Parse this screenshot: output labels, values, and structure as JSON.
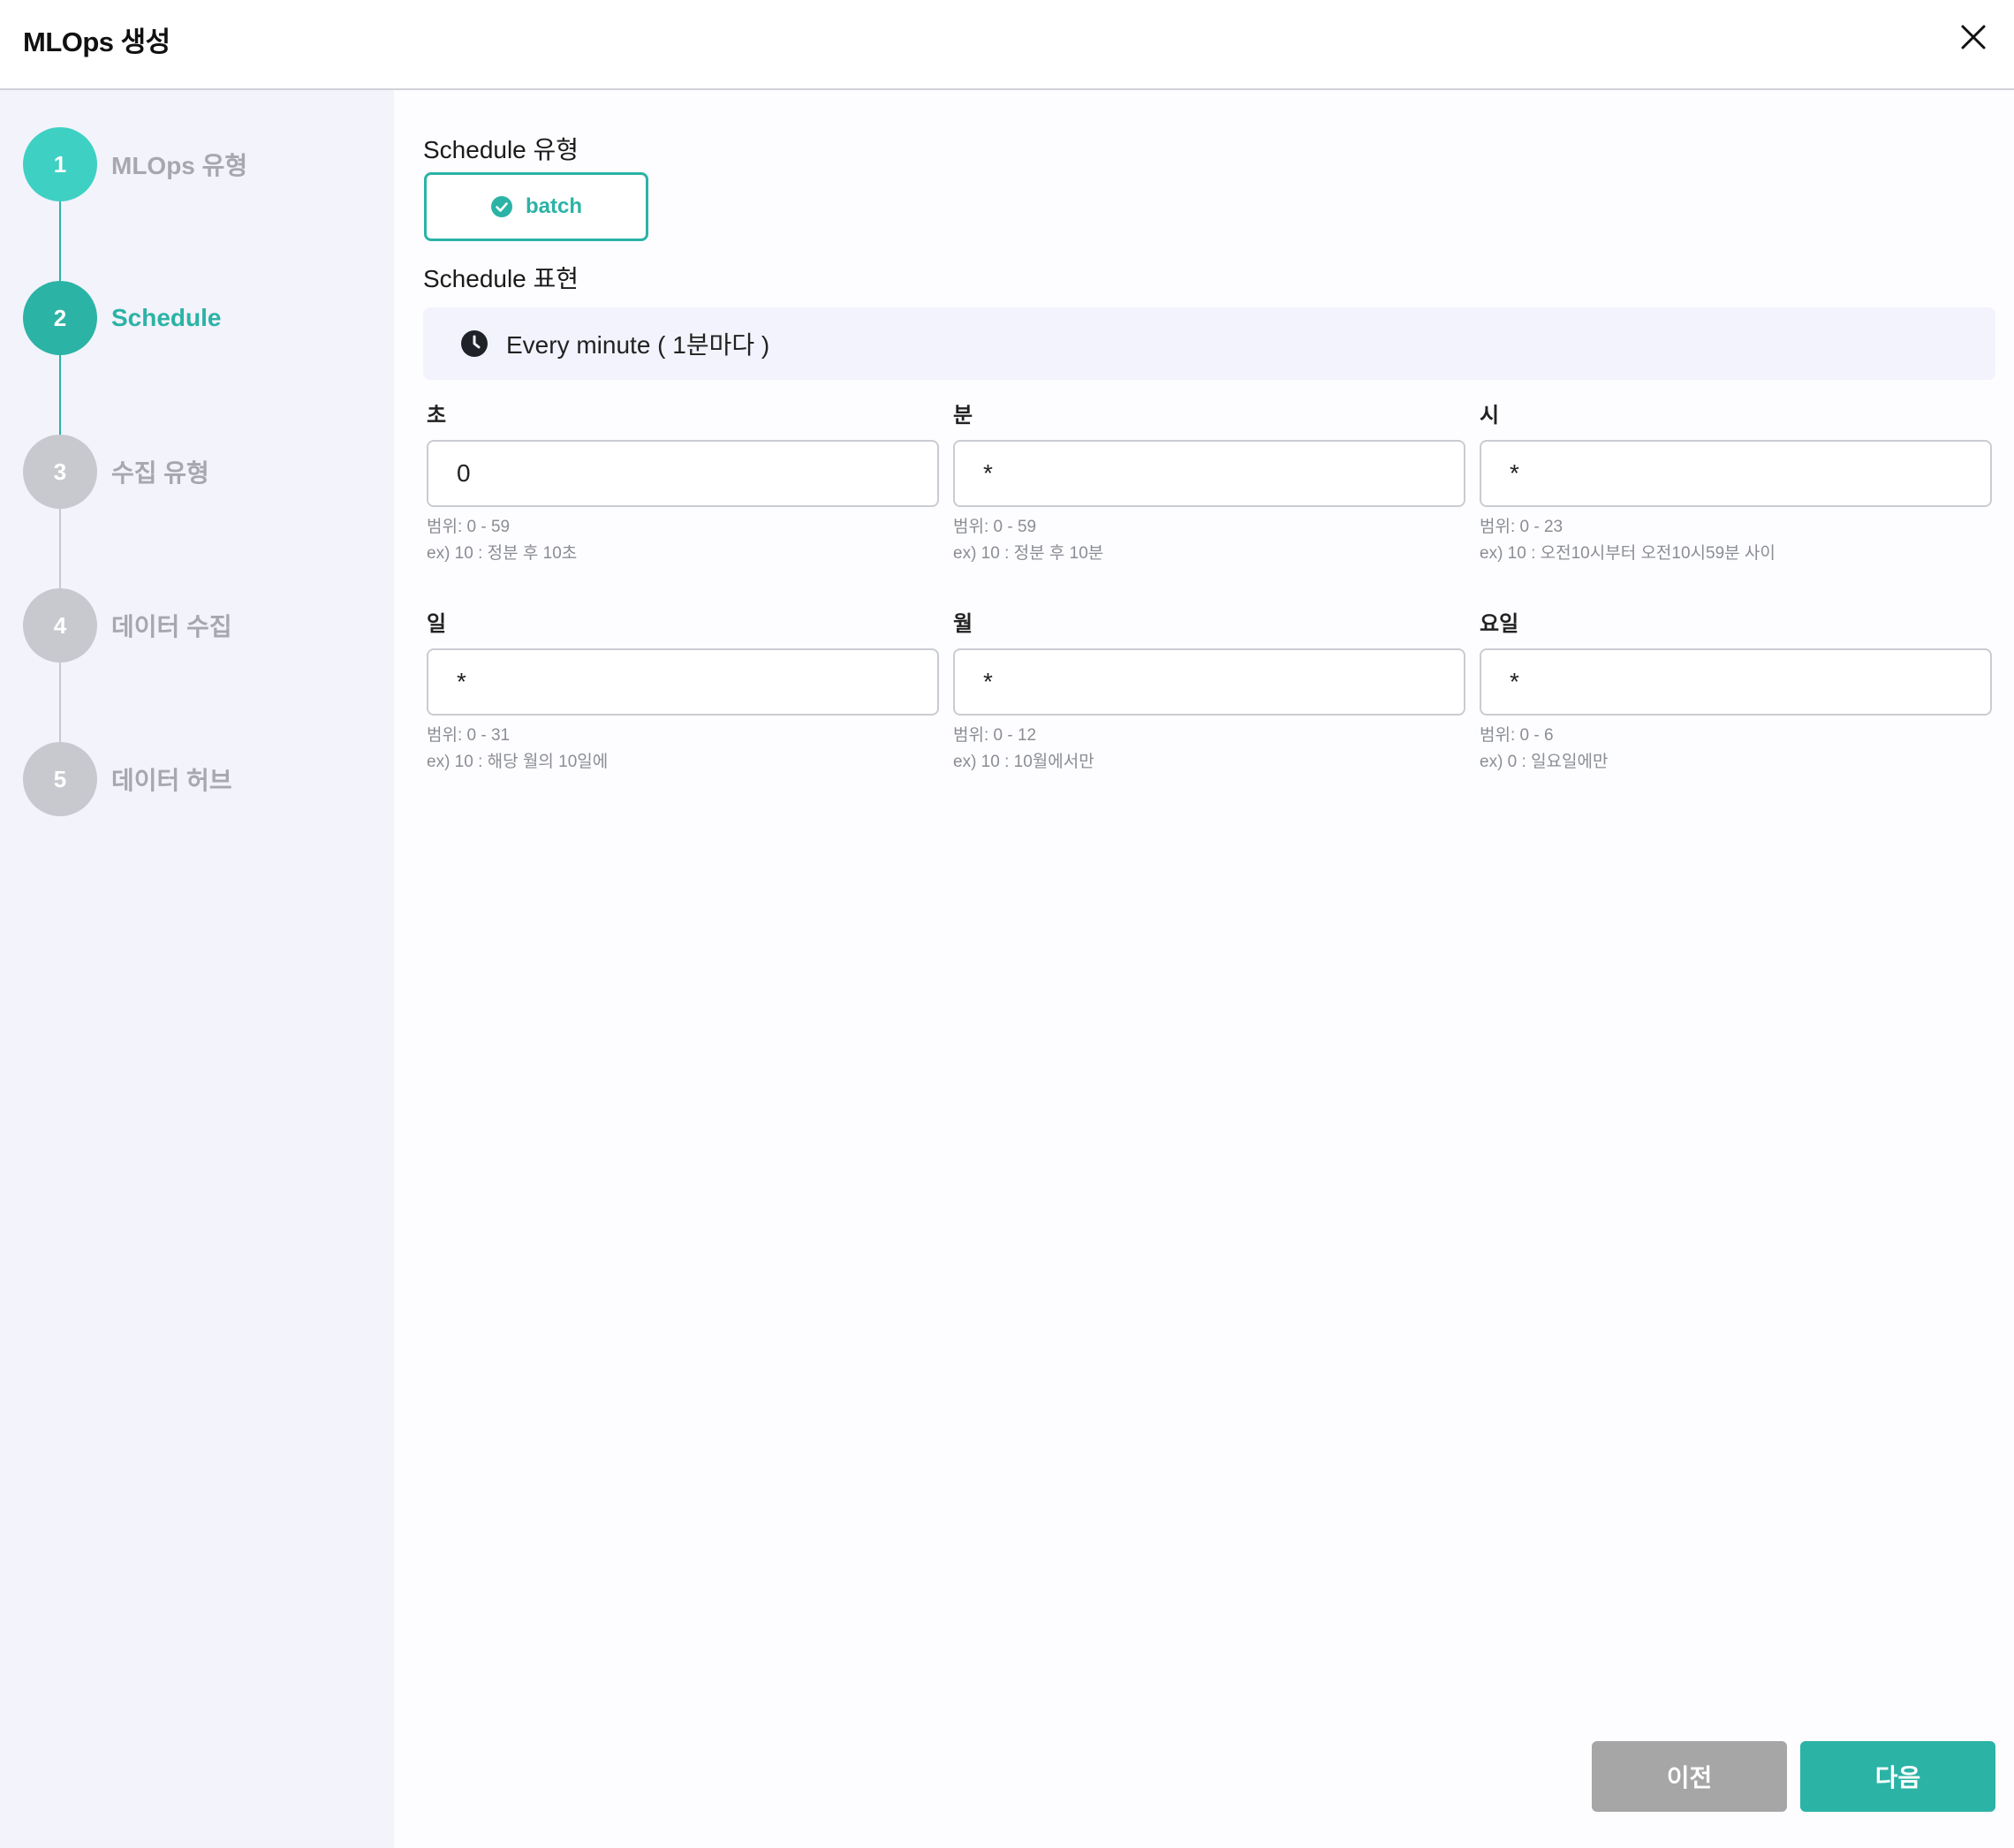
{
  "header": {
    "title": "MLOps 생성",
    "close_icon": "close-icon"
  },
  "steps": [
    {
      "number": "1",
      "label": "MLOps 유형",
      "state": "done"
    },
    {
      "number": "2",
      "label": "Schedule",
      "state": "active"
    },
    {
      "number": "3",
      "label": "수집 유형",
      "state": "pending"
    },
    {
      "number": "4",
      "label": "데이터 수집",
      "state": "pending"
    },
    {
      "number": "5",
      "label": "데이터 허브",
      "state": "pending"
    }
  ],
  "schedule_type": {
    "label": "Schedule 유형",
    "option": "batch",
    "icon": "check-circle-icon"
  },
  "schedule_expression": {
    "label": "Schedule 표현",
    "text": "Every minute ( 1분마다 )",
    "icon": "clock-icon"
  },
  "fields": {
    "second": {
      "label": "초",
      "value": "0",
      "range": "범위: 0 - 59",
      "example": "ex) 10 : 정분 후 10초"
    },
    "minute": {
      "label": "분",
      "value": "*",
      "range": "범위: 0 - 59",
      "example": "ex) 10 : 정분 후 10분"
    },
    "hour": {
      "label": "시",
      "value": "*",
      "range": "범위: 0 - 23",
      "example": "ex) 10 : 오전10시부터 오전10시59분 사이"
    },
    "day": {
      "label": "일",
      "value": "*",
      "range": "범위: 0 - 31",
      "example": "ex) 10 : 해당 월의 10일에"
    },
    "month": {
      "label": "월",
      "value": "*",
      "range": "범위: 0 - 12",
      "example": "ex) 10 : 10월에서만"
    },
    "weekday": {
      "label": "요일",
      "value": "*",
      "range": "범위: 0 - 6",
      "example": "ex) 0 : 일요일에만"
    }
  },
  "footer": {
    "prev_label": "이전",
    "next_label": "다음"
  },
  "colors": {
    "accent": "#2bb3a6",
    "done": "#3ed1c3",
    "pending": "#c8c9cf",
    "prev_button": "#a6a6a6"
  }
}
